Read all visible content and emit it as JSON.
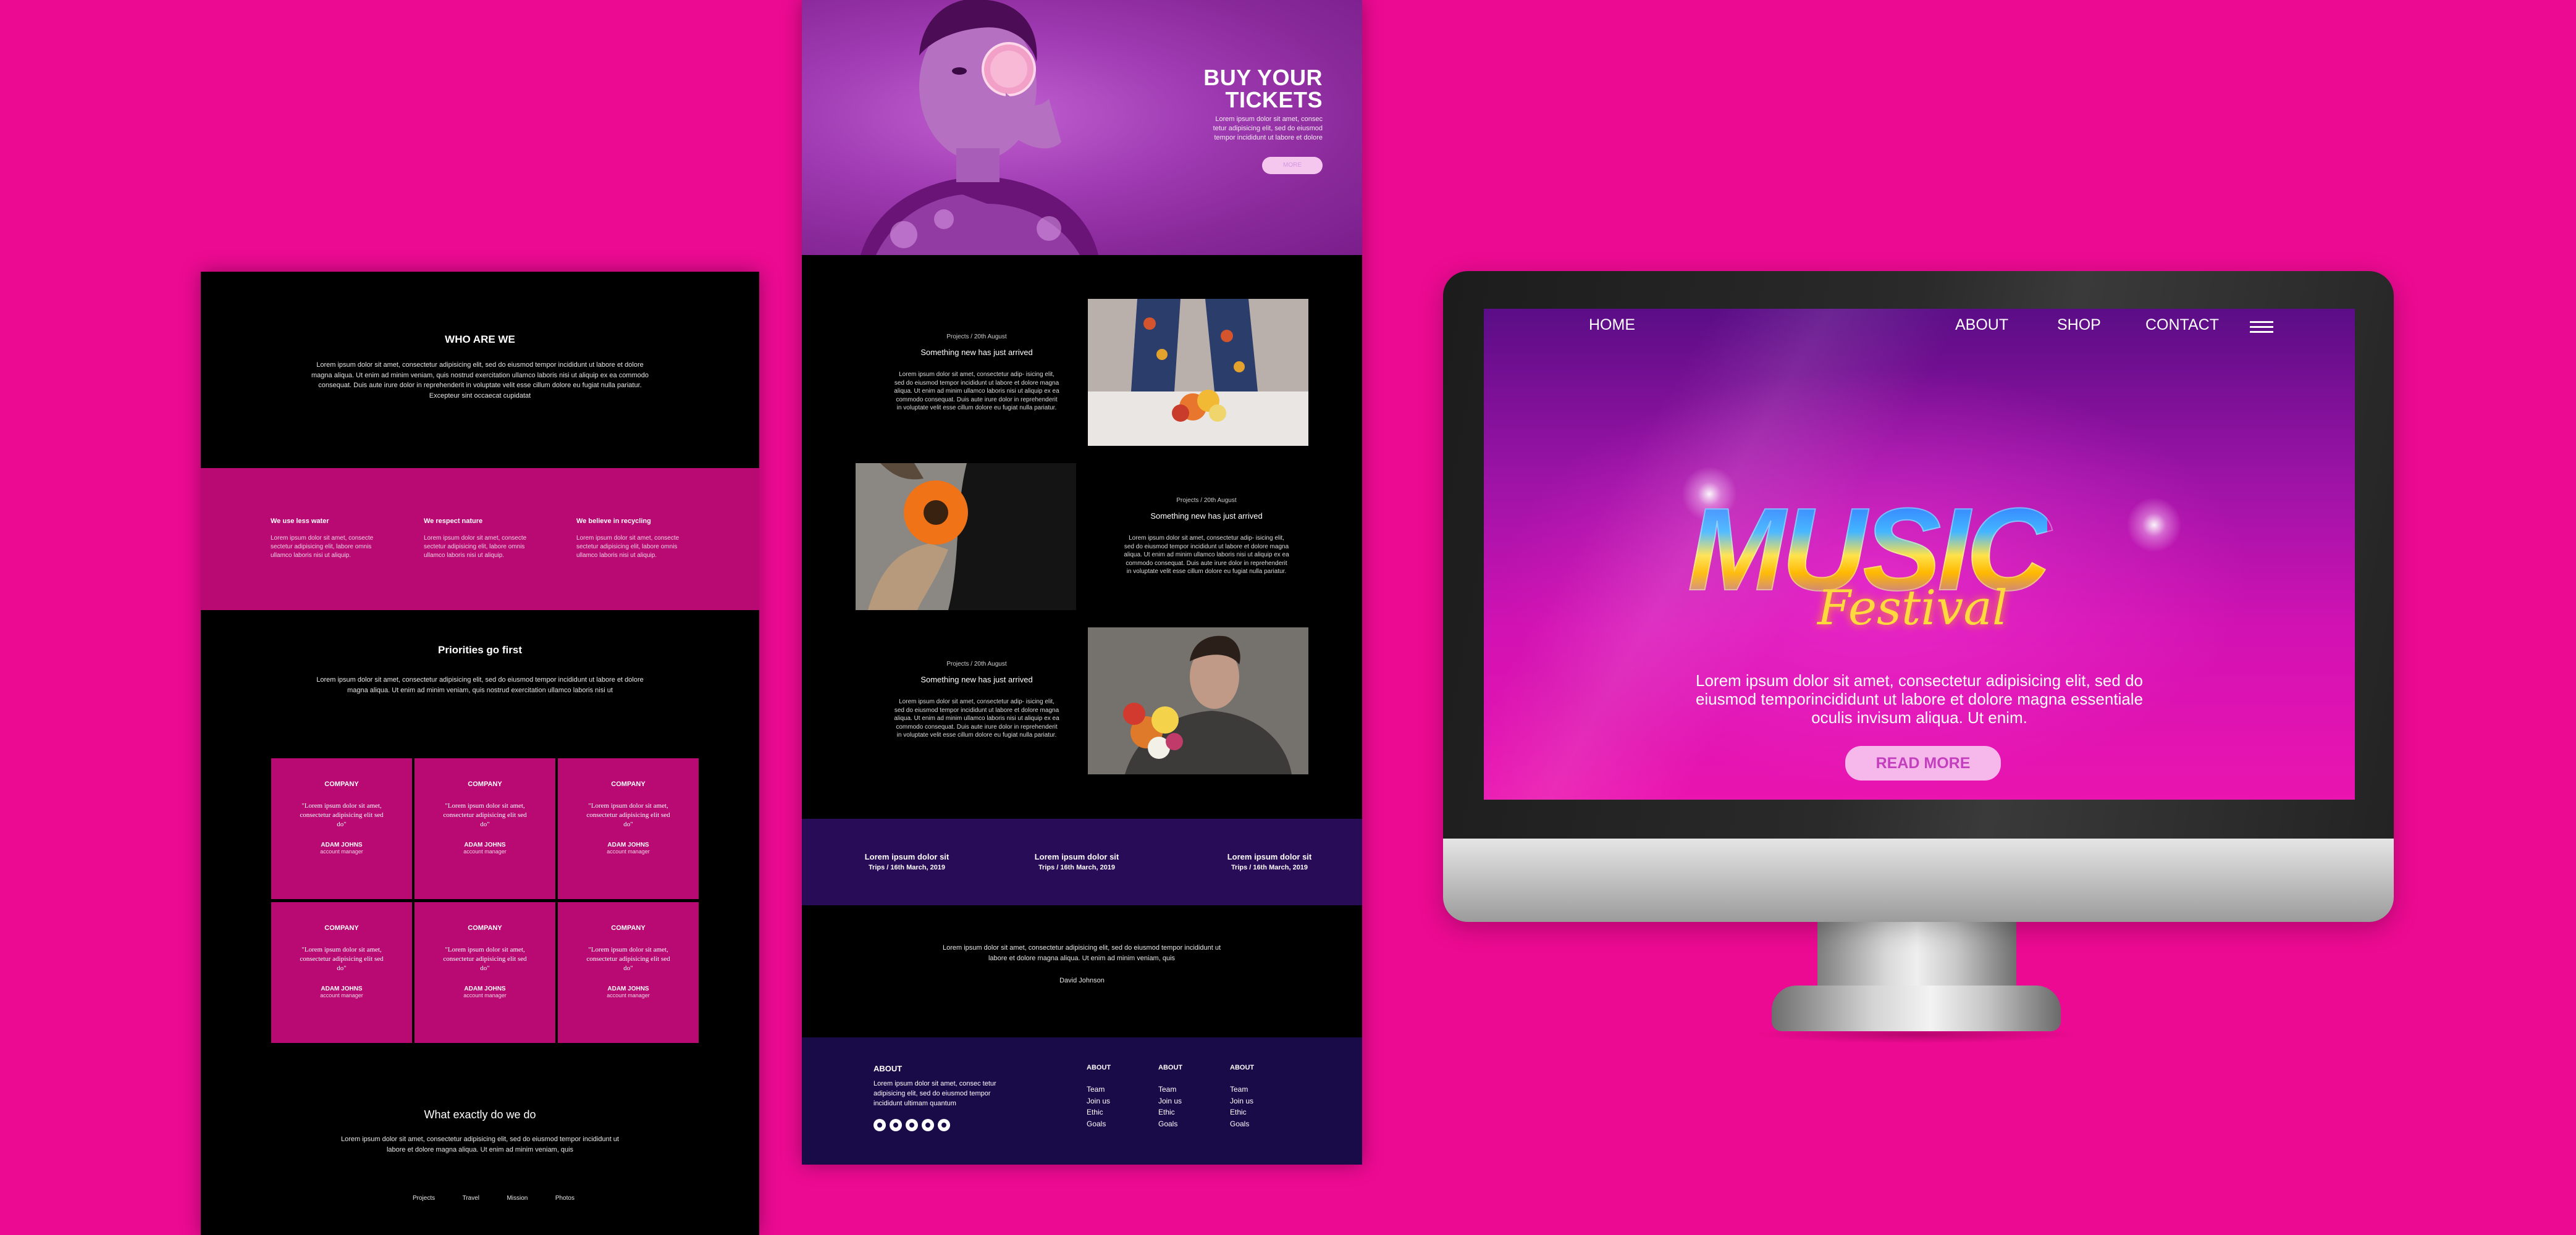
{
  "left_page": {
    "who_title": "WHO ARE WE",
    "who_text": "Lorem ipsum dolor sit amet, consectetur adipisicing elit, sed do eiusmod tempor incididunt ut labore et dolore magna aliqua. Ut enim ad minim veniam, quis nostrud exercitation ullamco laboris nisi ut aliquip ex ea commodo consequat. Duis aute irure dolor in reprehenderit in voluptate velit esse cillum dolore eu fugiat nulla pariatur. Excepteur sint occaecat cupidatat",
    "values": [
      {
        "title": "We use less water",
        "text": "Lorem ipsum dolor sit amet, consecte sectetur adipisicing elit, labore omnis ullamco laboris nisi ut aliquip."
      },
      {
        "title": "We respect nature",
        "text": "Lorem ipsum dolor sit amet, consecte sectetur adipisicing elit, labore omnis ullamco laboris nisi ut aliquip."
      },
      {
        "title": "We believe in recycling",
        "text": "Lorem ipsum dolor sit amet, consecte sectetur adipisicing elit, labore omnis ullamco laboris nisi ut aliquip."
      }
    ],
    "priorities_title": "Priorities go first",
    "priorities_text": "Lorem ipsum dolor sit amet, consectetur adipisicing elit, sed do eiusmod tempor incididunt ut labore et dolore magna aliqua. Ut enim ad minim veniam, quis nostrud exercitation ullamco laboris nisi ut",
    "testimonials": [
      {
        "company": "COMPANY",
        "quote": "\"Lorem ipsum dolor sit amet, consectetur adipisicing elit sed do\"",
        "name": "ADAM JOHNS",
        "role": "account manager"
      },
      {
        "company": "COMPANY",
        "quote": "\"Lorem ipsum dolor sit amet, consectetur adipisicing elit sed do\"",
        "name": "ADAM JOHNS",
        "role": "account manager"
      },
      {
        "company": "COMPANY",
        "quote": "\"Lorem ipsum dolor sit amet, consectetur adipisicing elit sed do\"",
        "name": "ADAM JOHNS",
        "role": "account manager"
      },
      {
        "company": "COMPANY",
        "quote": "\"Lorem ipsum dolor sit amet, consectetur adipisicing elit sed do\"",
        "name": "ADAM JOHNS",
        "role": "account manager"
      },
      {
        "company": "COMPANY",
        "quote": "\"Lorem ipsum dolor sit amet, consectetur adipisicing elit sed do\"",
        "name": "ADAM JOHNS",
        "role": "account manager"
      },
      {
        "company": "COMPANY",
        "quote": "\"Lorem ipsum dolor sit amet, consectetur adipisicing elit sed do\"",
        "name": "ADAM JOHNS",
        "role": "account manager"
      }
    ],
    "what_title": "What exactly do we do",
    "what_text": "Lorem ipsum dolor sit amet, consectetur adipisicing elit, sed do eiusmod tempor incididunt ut labore et dolore magna aliqua. Ut enim ad minim veniam, quis",
    "footer_links": [
      "Projects",
      "Travel",
      "Mission",
      "Photos"
    ]
  },
  "middle_page": {
    "hero_title_line1": "BUY YOUR",
    "hero_title_line2": "TICKETS",
    "hero_text": "Lorem ipsum dolor sit amet, consec tetur adipisicing elit, sed do eiusmod tempor incididunt ut labore et dolore",
    "hero_button": "MORE",
    "posts": [
      {
        "meta": "Projects / 20th August",
        "title": "Something new has just arrived",
        "body": "Lorem ipsum dolor sit amet, consectetur adip- isicing elit, sed do eiusmod tempor incididunt ut labore et dolore magna aliqua. Ut enim ad minim ullamco laboris nisi ut aliquip ex ea commodo consequat. Duis aute irure dolor in reprehenderit in voluptate velit esse cillum dolore eu fugiat nulla pariatur."
      },
      {
        "meta": "Projects / 20th August",
        "title": "Something new has just arrived",
        "body": "Lorem ipsum dolor sit amet, consectetur adip- isicing elit, sed do eiusmod tempor incididunt ut labore et dolore magna aliqua. Ut enim ad minim ullamco laboris nisi ut aliquip ex ea commodo consequat. Duis aute irure dolor in reprehenderit in voluptate velit esse cillum dolore eu fugiat nulla pariatur."
      },
      {
        "meta": "Projects / 20th August",
        "title": "Something new has just arrived",
        "body": "Lorem ipsum dolor sit amet, consectetur adip- isicing elit, sed do eiusmod tempor incididunt ut labore et dolore magna aliqua. Ut enim ad minim ullamco laboris nisi ut aliquip ex ea commodo consequat. Duis aute irure dolor in reprehenderit in voluptate velit esse cillum dolore eu fugiat nulla pariatur."
      }
    ],
    "trips": [
      {
        "title": "Lorem ipsum dolor sit",
        "date": "Trips / 16th March, 2019"
      },
      {
        "title": "Lorem ipsum dolor sit",
        "date": "Trips / 16th March, 2019"
      },
      {
        "title": "Lorem ipsum dolor sit",
        "date": "Trips / 16th March, 2019"
      }
    ],
    "quote_text": "Lorem ipsum dolor sit amet, consectetur adipisicing elit, sed do eiusmod tempor incididunt ut labore et dolore magna aliqua. Ut enim ad minim veniam, quis",
    "quote_author": "David Johnson",
    "footer": {
      "about_title": "ABOUT",
      "about_text": "Lorem ipsum dolor sit amet, consec tetur adipisicing elit, sed do eiusmod tempor incididunt ultimam quantum",
      "columns": [
        {
          "title": "ABOUT",
          "links": [
            "Team",
            "Join us",
            "Ethic",
            "Goals"
          ]
        },
        {
          "title": "ABOUT",
          "links": [
            "Team",
            "Join us",
            "Ethic",
            "Goals"
          ]
        },
        {
          "title": "ABOUT",
          "links": [
            "Team",
            "Join us",
            "Ethic",
            "Goals"
          ]
        }
      ],
      "social_icons": [
        "facebook-icon",
        "instagram-icon",
        "twitter-icon",
        "youtube-icon",
        "snapchat-icon"
      ]
    }
  },
  "monitor": {
    "nav": {
      "home": "HOME",
      "about": "ABOUT",
      "shop": "SHOP",
      "contact": "CONTACT",
      "menu_icon": "hamburger-menu-icon"
    },
    "logo_main": "MUSIC",
    "logo_script": "Festival",
    "text": "Lorem ipsum dolor sit amet, consectetur adipisicing elit, sed do eiusmod temporincididunt ut labore et dolore magna essentiale oculis invisum aliqua. Ut enim.",
    "button": "READ MORE"
  },
  "colors": {
    "background": "#ec0a92",
    "band_magenta": "#b80a72",
    "trips_band": "#290c57",
    "footer_band": "#190a48",
    "hero_purple": "#a03bb3",
    "button_pink": "#f6b8ea"
  }
}
